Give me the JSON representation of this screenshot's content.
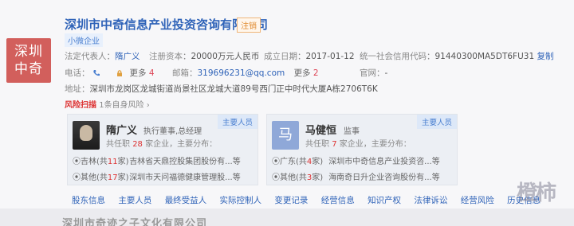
{
  "company": {
    "logo_text_line1": "深圳",
    "logo_text_line2": "中奇",
    "name": "深圳市中奇信息产业投资咨询有限公司",
    "status_tag": "注销",
    "size_tag": "小微企业"
  },
  "info": {
    "legal_rep_label": "法定代表人：",
    "legal_rep": "隋广义",
    "reg_capital_label": "注册资本：",
    "reg_capital": "20000万元人民币",
    "founded_label": "成立日期：",
    "founded": "2017-01-12",
    "credit_code_label": "统一社会信用代码：",
    "credit_code": "91440300MA5DT6FU31",
    "copy_label": "复制",
    "phone_label": "电话：",
    "more_phone_label": "更多",
    "more_phone_count": "4",
    "email_label": "邮箱：",
    "email": "319696231@qq.com",
    "more_email_label": "更多",
    "more_email_count": "2",
    "website_label": "官网：",
    "website": "-",
    "address_label": "地址：",
    "address": "深圳市龙岗区龙城街道尚景社区龙城大道89号西门正中时代大厦A栋2706T6K"
  },
  "risk": {
    "label": "风险扫描",
    "count_text": "1",
    "suffix": "条自身风险",
    "arrow": "›"
  },
  "persons": [
    {
      "name": "隋广义",
      "role": "执行董事,总经理",
      "badge": "主要人员",
      "count_prefix": "共任职",
      "count": "28",
      "count_suffix": "家企业，主要分布：",
      "lines": [
        {
          "loc_prefix": "吉林(共",
          "loc_n": "11",
          "loc_suffix": "家)",
          "company": "吉林省天鼎控股集团股份有...等"
        },
        {
          "loc_prefix": "其他(共",
          "loc_n": "17",
          "loc_suffix": "家)",
          "company": "深圳市天问福德健康管理股...等"
        }
      ]
    },
    {
      "name": "马健恒",
      "avatar_char": "马",
      "role": "监事",
      "badge": "主要人员",
      "count_prefix": "共任职",
      "count": "7",
      "count_suffix": "家企业，主要分布：",
      "lines": [
        {
          "loc_prefix": "广东(共",
          "loc_n": "4",
          "loc_suffix": "家)",
          "company": "深圳市中奇信息产业投资咨...等"
        },
        {
          "loc_prefix": "其他(共",
          "loc_n": "3",
          "loc_suffix": "家)",
          "company": "海南奇日升企业咨询股份有...等"
        }
      ]
    }
  ],
  "tabs": [
    "股东信息",
    "主要人员",
    "最终受益人",
    "实际控制人",
    "变更记录",
    "经营信息",
    "知识产权",
    "法律诉讼",
    "经营风险",
    "历史信息"
  ],
  "bottom_text": "深圳市奇迹之子文化有限公司",
  "watermark": "橙柿",
  "colors": {
    "link": "#2f63b8",
    "risk": "#d33333",
    "logo_bg": "#d25f5c"
  }
}
